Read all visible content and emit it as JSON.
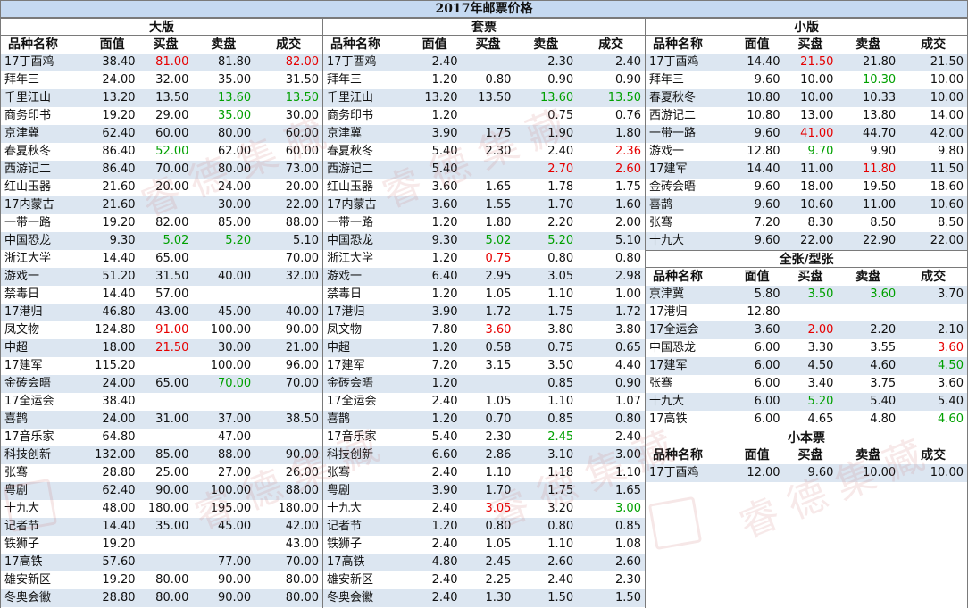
{
  "title": "2017年邮票价格",
  "headers": [
    "品种名称",
    "面值",
    "买盘",
    "卖盘",
    "成交"
  ],
  "colors": {
    "header_bg": "#c5d9f1",
    "band_bg": "#dce6f1",
    "up": "#e60000",
    "down": "#00a000"
  },
  "watermark": "睿德集藏",
  "sections": {
    "dabam": {
      "title": "大版",
      "rows": [
        [
          "17丁酉鸡",
          "38.40",
          "81.00",
          "81.80",
          "82.00"
        ],
        [
          "拜年三",
          "24.00",
          "32.00",
          "35.00",
          "31.50"
        ],
        [
          "千里江山",
          "13.20",
          "13.50",
          "13.60",
          "13.50"
        ],
        [
          "商务印书",
          "19.20",
          "29.00",
          "35.00",
          "30.00"
        ],
        [
          "京津冀",
          "62.40",
          "60.00",
          "80.00",
          "60.00"
        ],
        [
          "春夏秋冬",
          "86.40",
          "52.00",
          "62.00",
          "60.00"
        ],
        [
          "西游记二",
          "86.40",
          "70.00",
          "80.00",
          "73.00"
        ],
        [
          "红山玉器",
          "21.60",
          "20.00",
          "24.00",
          "20.00"
        ],
        [
          "17内蒙古",
          "21.60",
          "",
          "30.00",
          "22.00"
        ],
        [
          "一带一路",
          "19.20",
          "82.00",
          "85.00",
          "88.00"
        ],
        [
          "中国恐龙",
          "9.30",
          "5.02",
          "5.20",
          "5.10"
        ],
        [
          "浙江大学",
          "14.40",
          "65.00",
          "",
          "70.00"
        ],
        [
          "游戏一",
          "51.20",
          "31.50",
          "40.00",
          "32.00"
        ],
        [
          "禁毒日",
          "14.40",
          "57.00",
          "",
          ""
        ],
        [
          "17港归",
          "46.80",
          "43.00",
          "45.00",
          "40.00"
        ],
        [
          "凤文物",
          "124.80",
          "91.00",
          "100.00",
          "90.00"
        ],
        [
          "中超",
          "18.00",
          "21.50",
          "30.00",
          "21.00"
        ],
        [
          "17建军",
          "115.20",
          "",
          "100.00",
          "96.00"
        ],
        [
          "金砖会晤",
          "24.00",
          "65.00",
          "70.00",
          "70.00"
        ],
        [
          "17全运会",
          "38.40",
          "",
          "",
          ""
        ],
        [
          "喜鹊",
          "24.00",
          "31.00",
          "37.00",
          "38.50"
        ],
        [
          "17音乐家",
          "64.80",
          "",
          "47.00",
          ""
        ],
        [
          "科技创新",
          "132.00",
          "85.00",
          "88.00",
          "90.00"
        ],
        [
          "张骞",
          "28.80",
          "25.00",
          "27.00",
          "26.00"
        ],
        [
          "粤剧",
          "62.40",
          "90.00",
          "100.00",
          "88.00"
        ],
        [
          "十九大",
          "48.00",
          "180.00",
          "195.00",
          "180.00"
        ],
        [
          "记者节",
          "14.40",
          "35.00",
          "45.00",
          "42.00"
        ],
        [
          "铁狮子",
          "19.20",
          "",
          "",
          "43.00"
        ],
        [
          "17高铁",
          "57.60",
          "",
          "77.00",
          "70.00"
        ],
        [
          "雄安新区",
          "19.20",
          "80.00",
          "90.00",
          "80.00"
        ],
        [
          "冬奥会徽",
          "28.80",
          "80.00",
          "90.00",
          "80.00"
        ]
      ],
      "colored": [
        [
          0,
          2,
          "red"
        ],
        [
          0,
          4,
          "red"
        ],
        [
          2,
          3,
          "green"
        ],
        [
          2,
          4,
          "green"
        ],
        [
          3,
          3,
          "green"
        ],
        [
          5,
          2,
          "green"
        ],
        [
          10,
          2,
          "green"
        ],
        [
          10,
          3,
          "green"
        ],
        [
          15,
          2,
          "red"
        ],
        [
          16,
          2,
          "red"
        ],
        [
          18,
          3,
          "green"
        ]
      ]
    },
    "taopiao": {
      "title": "套票",
      "rows": [
        [
          "17丁酉鸡",
          "2.40",
          "",
          "2.30",
          "2.40"
        ],
        [
          "拜年三",
          "1.20",
          "0.80",
          "0.90",
          "0.90"
        ],
        [
          "千里江山",
          "13.20",
          "13.50",
          "13.60",
          "13.50"
        ],
        [
          "商务印书",
          "1.20",
          "",
          "0.75",
          "0.76"
        ],
        [
          "京津冀",
          "3.90",
          "1.75",
          "1.90",
          "1.80"
        ],
        [
          "春夏秋冬",
          "5.40",
          "2.30",
          "2.40",
          "2.36"
        ],
        [
          "西游记二",
          "5.40",
          "",
          "2.70",
          "2.60"
        ],
        [
          "红山玉器",
          "3.60",
          "1.65",
          "1.78",
          "1.75"
        ],
        [
          "17内蒙古",
          "3.60",
          "1.55",
          "1.70",
          "1.60"
        ],
        [
          "一带一路",
          "1.20",
          "1.80",
          "2.20",
          "2.00"
        ],
        [
          "中国恐龙",
          "9.30",
          "5.02",
          "5.20",
          "5.10"
        ],
        [
          "浙江大学",
          "1.20",
          "0.75",
          "0.80",
          "0.80"
        ],
        [
          "游戏一",
          "6.40",
          "2.95",
          "3.05",
          "2.98"
        ],
        [
          "禁毒日",
          "1.20",
          "1.05",
          "1.10",
          "1.00"
        ],
        [
          "17港归",
          "3.90",
          "1.72",
          "1.75",
          "1.72"
        ],
        [
          "凤文物",
          "7.80",
          "3.60",
          "3.80",
          "3.80"
        ],
        [
          "中超",
          "1.20",
          "0.58",
          "0.75",
          "0.65"
        ],
        [
          "17建军",
          "7.20",
          "3.15",
          "3.50",
          "4.40"
        ],
        [
          "金砖会晤",
          "1.20",
          "",
          "0.85",
          "0.90"
        ],
        [
          "17全运会",
          "2.40",
          "1.05",
          "1.10",
          "1.07"
        ],
        [
          "喜鹊",
          "1.20",
          "0.70",
          "0.85",
          "0.80"
        ],
        [
          "17音乐家",
          "5.40",
          "2.30",
          "2.45",
          "2.40"
        ],
        [
          "科技创新",
          "6.60",
          "2.86",
          "3.10",
          "3.00"
        ],
        [
          "张骞",
          "2.40",
          "1.10",
          "1.18",
          "1.10"
        ],
        [
          "粤剧",
          "3.90",
          "1.70",
          "1.75",
          "1.65"
        ],
        [
          "十九大",
          "2.40",
          "3.05",
          "3.20",
          "3.00"
        ],
        [
          "记者节",
          "1.20",
          "0.80",
          "0.80",
          "0.85"
        ],
        [
          "铁狮子",
          "2.40",
          "1.05",
          "1.10",
          "1.08"
        ],
        [
          "17高铁",
          "4.80",
          "2.45",
          "2.60",
          "2.60"
        ],
        [
          "雄安新区",
          "2.40",
          "2.25",
          "2.40",
          "2.30"
        ],
        [
          "冬奥会徽",
          "2.40",
          "1.30",
          "1.50",
          "1.50"
        ]
      ],
      "colored": [
        [
          2,
          3,
          "green"
        ],
        [
          2,
          4,
          "green"
        ],
        [
          5,
          4,
          "red"
        ],
        [
          6,
          3,
          "red"
        ],
        [
          6,
          4,
          "red"
        ],
        [
          10,
          2,
          "green"
        ],
        [
          10,
          3,
          "green"
        ],
        [
          11,
          2,
          "red"
        ],
        [
          15,
          2,
          "red"
        ],
        [
          21,
          3,
          "green"
        ],
        [
          25,
          2,
          "red"
        ],
        [
          25,
          4,
          "green"
        ]
      ]
    },
    "xiaoban": {
      "title": "小版",
      "rows": [
        [
          "17丁酉鸡",
          "14.40",
          "21.50",
          "21.80",
          "21.50"
        ],
        [
          "拜年三",
          "9.60",
          "10.00",
          "10.30",
          "10.00"
        ],
        [
          "春夏秋冬",
          "10.80",
          "10.00",
          "10.33",
          "10.00"
        ],
        [
          "西游记二",
          "10.80",
          "13.00",
          "13.80",
          "14.00"
        ],
        [
          "一带一路",
          "9.60",
          "41.00",
          "44.70",
          "42.00"
        ],
        [
          "游戏一",
          "12.80",
          "9.70",
          "9.90",
          "9.80"
        ],
        [
          "17建军",
          "14.40",
          "11.00",
          "11.80",
          "11.50"
        ],
        [
          "金砖会晤",
          "9.60",
          "18.00",
          "19.50",
          "18.60"
        ],
        [
          "喜鹊",
          "9.60",
          "10.60",
          "11.00",
          "10.60"
        ],
        [
          "张骞",
          "7.20",
          "8.30",
          "8.50",
          "8.50"
        ],
        [
          "十九大",
          "9.60",
          "22.00",
          "22.90",
          "22.00"
        ]
      ],
      "colored": [
        [
          0,
          2,
          "red"
        ],
        [
          1,
          3,
          "green"
        ],
        [
          4,
          2,
          "red"
        ],
        [
          5,
          2,
          "green"
        ],
        [
          6,
          3,
          "red"
        ]
      ]
    },
    "quanzhang": {
      "title": "全张/型张",
      "rows": [
        [
          "京津冀",
          "5.80",
          "3.50",
          "3.60",
          "3.70"
        ],
        [
          "17港归",
          "12.80",
          "",
          "",
          ""
        ],
        [
          "17全运会",
          "3.60",
          "2.00",
          "2.20",
          "2.10"
        ],
        [
          "中国恐龙",
          "6.00",
          "3.30",
          "3.55",
          "3.60"
        ],
        [
          "17建军",
          "6.00",
          "4.50",
          "4.60",
          "4.50"
        ],
        [
          "张骞",
          "6.00",
          "3.40",
          "3.75",
          "3.60"
        ],
        [
          "十九大",
          "6.00",
          "5.20",
          "5.40",
          "5.40"
        ],
        [
          "17高铁",
          "6.00",
          "4.65",
          "4.80",
          "4.60"
        ]
      ],
      "colored": [
        [
          0,
          2,
          "green"
        ],
        [
          0,
          3,
          "green"
        ],
        [
          2,
          2,
          "red"
        ],
        [
          3,
          4,
          "red"
        ],
        [
          4,
          4,
          "green"
        ],
        [
          6,
          2,
          "green"
        ],
        [
          7,
          4,
          "green"
        ]
      ]
    },
    "xiaobenpiao": {
      "title": "小本票",
      "rows": [
        [
          "17丁酉鸡",
          "12.00",
          "9.60",
          "10.00",
          "10.00"
        ]
      ],
      "colored": []
    }
  }
}
